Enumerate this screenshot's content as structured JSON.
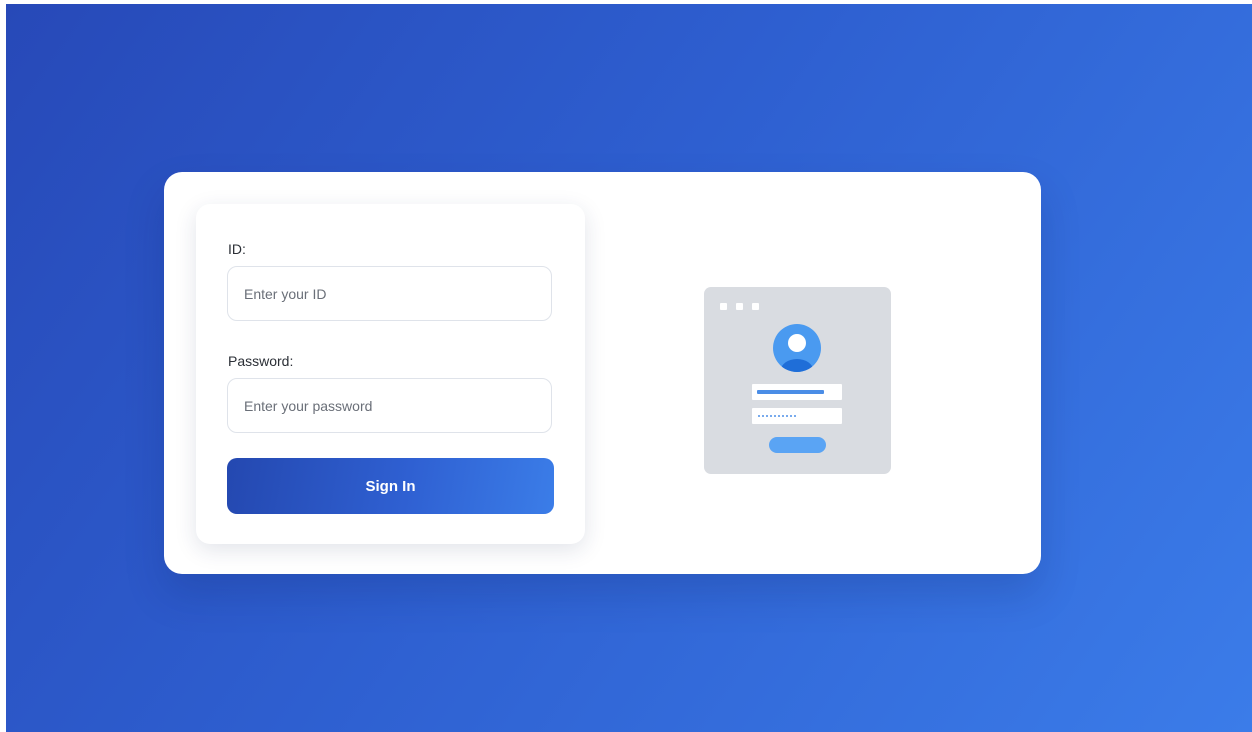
{
  "form": {
    "id_label": "ID:",
    "id_placeholder": "Enter your ID",
    "password_label": "Password:",
    "password_placeholder": "Enter your password",
    "submit_label": "Sign In"
  },
  "icons": {
    "illustration": "login-window-illustration",
    "avatar": "user-avatar-icon"
  },
  "colors": {
    "background_start": "#2749b8",
    "background_end": "#3b7ce9",
    "button_start": "#2448b0",
    "button_end": "#3b7de8",
    "illustration_bg": "#d9dce1",
    "illustration_accent": "#5aa4f4"
  }
}
